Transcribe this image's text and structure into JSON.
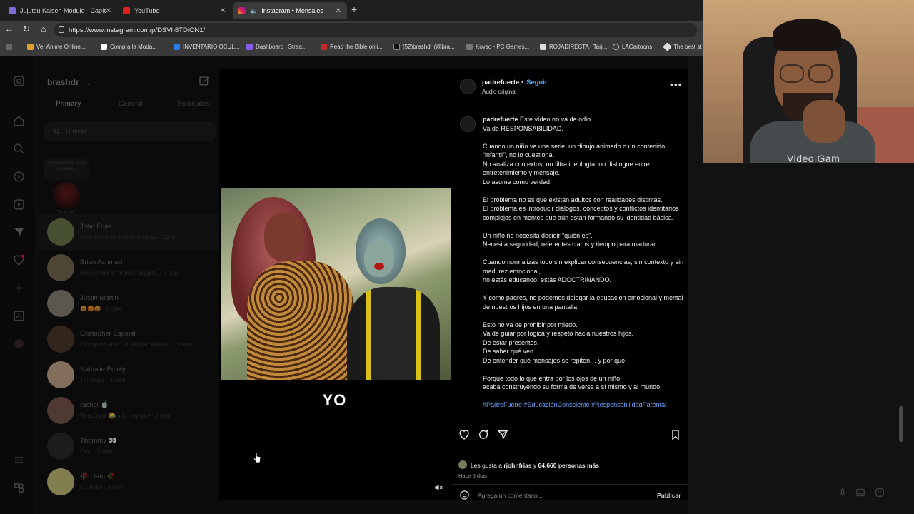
{
  "browser": {
    "tabs": [
      {
        "title": "Jujutsu Kaisen Módulo - Capítulo",
        "active": false
      },
      {
        "title": "YouTube",
        "active": false
      },
      {
        "title": "Instagram • Mensajes",
        "active": true
      }
    ],
    "url": "https://www.instagram.com/p/DSVh8TDiON1/",
    "bookmarks": [
      "Ver Anime Online...",
      "Compra la Moda...",
      "INVENTARIO OCUL...",
      "Dashboard | Strea...",
      "Read the Bible onli...",
      "(52)brashdr (@bra...",
      "Koyso - PC Games...",
      "ROJADIRECTA | Tarj...",
      "LACartoons",
      "The best st"
    ]
  },
  "inbox": {
    "username": "brashdr_",
    "tabs": [
      "Primary",
      "General",
      "Solicitudes"
    ],
    "search_placeholder": "Buscar",
    "note_bubble": "Primera nota de la semana...",
    "note_label": "Tu nota",
    "chats": [
      {
        "name": "John Frias",
        "preview": "John envió un archivo adjunto. · 12 h",
        "color": "#6f7b4d",
        "selected": true
      },
      {
        "name": "Brian Ashmed",
        "preview": "Brian envió un archivo adjunto. · 3 días",
        "color": "#7a6a52",
        "selected": false
      },
      {
        "name": "Justin Martin",
        "preview": "😡😡😡 · 6 días",
        "color": "#8d8579",
        "selected": false
      },
      {
        "name": "Cristopher Espinal",
        "preview": "Cristopher envió un archivo adjunto. · 1 sem",
        "color": "#4d3a2c",
        "selected": false
      },
      {
        "name": "Nathalie Emely",
        "preview": "Tú: Jajaja · 1 sem",
        "color": "#caa98e",
        "selected": false
      },
      {
        "name": "rachel 🍵",
        "preview": "Reaccionó 😂 a tu mensaje · 2 sem",
        "color": "#7a5a4e",
        "selected": false
      },
      {
        "name": "Thommy 👀",
        "preview": "Gevi · 3 sem",
        "color": "#2c2c2c",
        "selected": false
      },
      {
        "name": "🥀 Liam 🥀",
        "preview": "Tú: bobo · 3 sem",
        "color": "#c9c27a",
        "selected": false
      }
    ]
  },
  "media": {
    "caption": "YO"
  },
  "post": {
    "author": "padrefuerte",
    "follow": "Seguir",
    "audio": "Audio original",
    "caption_lines": [
      "Este vídeo no va de odio.",
      "Va de RESPONSABILIDAD.",
      "",
      "Cuando un niño ve una serie, un dibujo animado o un contenido “infantil”, no lo cuestiona.",
      "No analiza contextos, no filtra ideología, no distingue entre entretenimiento y mensaje.",
      "Lo asume como verdad.",
      "",
      "El problema no es que existan adultos con realidades distintas.",
      "El problema es introducir diálogos, conceptos y conflictos identitarios complejos en mentes que aún están formando su identidad básica.",
      "",
      "Un niño no necesita decidir “quién es”.",
      "Necesita seguridad, referentes claros y tiempo para madurar.",
      "",
      "Cuando normalizas todo sin explicar consecuencias, sin contexto y sin madurez emocional,",
      "no estás educando: estás ADOCTRINANDO.",
      "",
      "Y como padres, no podemos delegar la educación emocional y mental de nuestros hijos en una pantalla.",
      "",
      "Esto no va de prohibir por miedo.",
      "Va de guiar por lógica y respeto hacia nuestros hijos.",
      "De estar presentes.",
      "De saber qué ven.",
      "De entender qué mensajes se repiten… y por qué.",
      "",
      "Porque todo lo que entra por los ojos de un niño,",
      "acaba construyendo su forma de verse a sí mismo y al mundo."
    ],
    "hashtags": "#PadreFuerte #EducaciónConsciente #ResponsabilidadParental",
    "likes_prefix": "Les gusta a ",
    "likes_user": "rjohnfrias",
    "likes_mid": " y ",
    "likes_count": "64.660 personas más",
    "time_ago": "Hace 5 días",
    "comment_placeholder": "Agrega un comentario...",
    "publish": "Publicar"
  },
  "webcam": {
    "shirt_text": "Video Gam"
  },
  "colors": {
    "link": "#4da3ff",
    "hashtag": "#6fa8ff",
    "background": "#0c0c0c"
  }
}
